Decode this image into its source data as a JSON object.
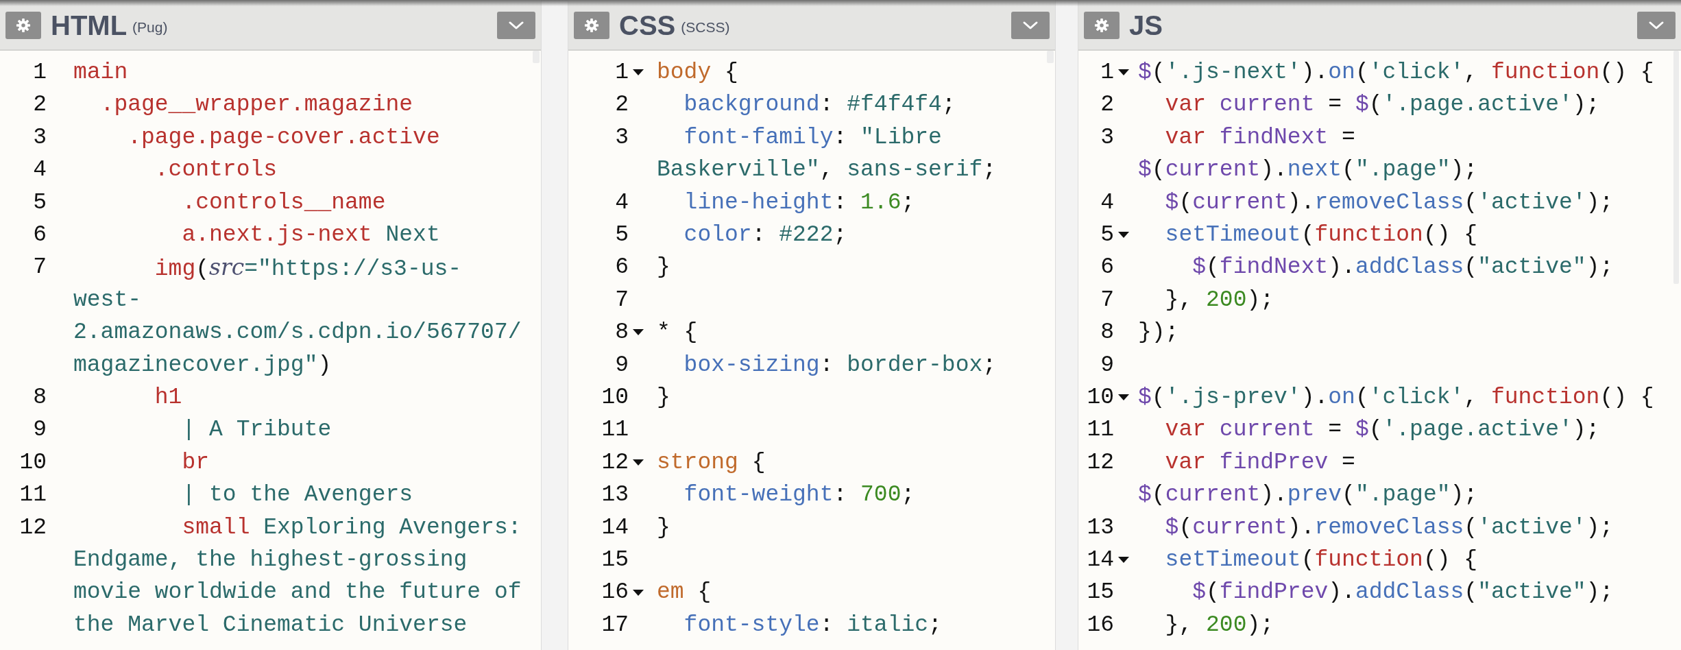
{
  "panes": [
    {
      "title": "HTML",
      "subtitle": "(Pug)",
      "lines": [
        {
          "number": "1",
          "fold": false,
          "rows": [
            {
              "tokens": [
                {
                  "kind": "tag",
                  "text": "main"
                }
              ]
            }
          ]
        },
        {
          "number": "2",
          "fold": false,
          "rows": [
            {
              "tokens": [
                {
                  "kind": "tag",
                  "text": "  .page__wrapper.magazine"
                }
              ]
            }
          ]
        },
        {
          "number": "3",
          "fold": false,
          "rows": [
            {
              "tokens": [
                {
                  "kind": "tag",
                  "text": "    .page.page-cover.active"
                }
              ]
            }
          ]
        },
        {
          "number": "4",
          "fold": false,
          "rows": [
            {
              "tokens": [
                {
                  "kind": "tag",
                  "text": "      .controls"
                }
              ]
            }
          ]
        },
        {
          "number": "5",
          "fold": false,
          "rows": [
            {
              "tokens": [
                {
                  "kind": "tag",
                  "text": "        .controls__name"
                }
              ]
            }
          ]
        },
        {
          "number": "6",
          "fold": false,
          "rows": [
            {
              "tokens": [
                {
                  "kind": "tag",
                  "text": "        a.next.js-next"
                },
                {
                  "kind": "string",
                  "text": " Next"
                }
              ]
            }
          ]
        },
        {
          "number": "7",
          "fold": false,
          "rows": [
            {
              "tokens": [
                {
                  "kind": "tag",
                  "text": "      img"
                },
                {
                  "kind": "plain",
                  "text": "("
                },
                {
                  "kind": "attribute",
                  "text": "src"
                },
                {
                  "kind": "string",
                  "text": "=\"https://s3-us-"
                }
              ]
            },
            {
              "tokens": [
                {
                  "kind": "string",
                  "text": "west-"
                }
              ]
            },
            {
              "tokens": [
                {
                  "kind": "string",
                  "text": "2.amazonaws.com/s.cdpn.io/567707/"
                }
              ]
            },
            {
              "tokens": [
                {
                  "kind": "string",
                  "text": "magazinecover.jpg\""
                },
                {
                  "kind": "plain",
                  "text": ")"
                }
              ]
            }
          ]
        },
        {
          "number": "8",
          "fold": false,
          "rows": [
            {
              "tokens": [
                {
                  "kind": "tag",
                  "text": "      h1"
                }
              ]
            }
          ]
        },
        {
          "number": "9",
          "fold": false,
          "rows": [
            {
              "tokens": [
                {
                  "kind": "string",
                  "text": "        | A Tribute"
                }
              ]
            }
          ]
        },
        {
          "number": "10",
          "fold": false,
          "rows": [
            {
              "tokens": [
                {
                  "kind": "tag",
                  "text": "        br"
                }
              ]
            }
          ]
        },
        {
          "number": "11",
          "fold": false,
          "rows": [
            {
              "tokens": [
                {
                  "kind": "string",
                  "text": "        | to the Avengers"
                }
              ]
            }
          ]
        },
        {
          "number": "12",
          "fold": false,
          "rows": [
            {
              "tokens": [
                {
                  "kind": "tag",
                  "text": "        small"
                },
                {
                  "kind": "string",
                  "text": " Exploring Avengers:"
                }
              ]
            },
            {
              "tokens": [
                {
                  "kind": "string",
                  "text": "Endgame, the highest-grossing"
                }
              ]
            },
            {
              "tokens": [
                {
                  "kind": "string",
                  "text": "movie worldwide and the future of"
                }
              ]
            },
            {
              "tokens": [
                {
                  "kind": "string",
                  "text": "the Marvel Cinematic Universe"
                }
              ]
            }
          ]
        }
      ]
    },
    {
      "title": "CSS",
      "subtitle": "(SCSS)",
      "lines": [
        {
          "number": "1",
          "fold": true,
          "rows": [
            {
              "tokens": [
                {
                  "kind": "selector",
                  "text": "body"
                },
                {
                  "kind": "plain",
                  "text": " {"
                }
              ]
            }
          ]
        },
        {
          "number": "2",
          "fold": false,
          "rows": [
            {
              "tokens": [
                {
                  "kind": "property",
                  "text": "  background"
                },
                {
                  "kind": "plain",
                  "text": ": "
                },
                {
                  "kind": "string",
                  "text": "#f4f4f4"
                },
                {
                  "kind": "plain",
                  "text": ";"
                }
              ]
            }
          ]
        },
        {
          "number": "3",
          "fold": false,
          "rows": [
            {
              "tokens": [
                {
                  "kind": "property",
                  "text": "  font-family"
                },
                {
                  "kind": "plain",
                  "text": ": "
                },
                {
                  "kind": "string",
                  "text": "\"Libre"
                }
              ]
            },
            {
              "tokens": [
                {
                  "kind": "string",
                  "text": "Baskerville\""
                },
                {
                  "kind": "plain",
                  "text": ", "
                },
                {
                  "kind": "string",
                  "text": "sans-serif"
                },
                {
                  "kind": "plain",
                  "text": ";"
                }
              ]
            }
          ]
        },
        {
          "number": "4",
          "fold": false,
          "rows": [
            {
              "tokens": [
                {
                  "kind": "property",
                  "text": "  line-height"
                },
                {
                  "kind": "plain",
                  "text": ": "
                },
                {
                  "kind": "number",
                  "text": "1.6"
                },
                {
                  "kind": "plain",
                  "text": ";"
                }
              ]
            }
          ]
        },
        {
          "number": "5",
          "fold": false,
          "rows": [
            {
              "tokens": [
                {
                  "kind": "property",
                  "text": "  color"
                },
                {
                  "kind": "plain",
                  "text": ": "
                },
                {
                  "kind": "string",
                  "text": "#222"
                },
                {
                  "kind": "plain",
                  "text": ";"
                }
              ]
            }
          ]
        },
        {
          "number": "6",
          "fold": false,
          "rows": [
            {
              "tokens": [
                {
                  "kind": "plain",
                  "text": "}"
                }
              ]
            }
          ]
        },
        {
          "number": "7",
          "fold": false
        },
        {
          "number": "8",
          "fold": true,
          "rows": [
            {
              "tokens": [
                {
                  "kind": "plain",
                  "text": "* {"
                }
              ]
            }
          ]
        },
        {
          "number": "9",
          "fold": false,
          "rows": [
            {
              "tokens": [
                {
                  "kind": "property",
                  "text": "  box-sizing"
                },
                {
                  "kind": "plain",
                  "text": ": "
                },
                {
                  "kind": "string",
                  "text": "border-box"
                },
                {
                  "kind": "plain",
                  "text": ";"
                }
              ]
            }
          ]
        },
        {
          "number": "10",
          "fold": false,
          "rows": [
            {
              "tokens": [
                {
                  "kind": "plain",
                  "text": "}"
                }
              ]
            }
          ]
        },
        {
          "number": "11",
          "fold": false
        },
        {
          "number": "12",
          "fold": true,
          "rows": [
            {
              "tokens": [
                {
                  "kind": "selector",
                  "text": "strong"
                },
                {
                  "kind": "plain",
                  "text": " {"
                }
              ]
            }
          ]
        },
        {
          "number": "13",
          "fold": false,
          "rows": [
            {
              "tokens": [
                {
                  "kind": "property",
                  "text": "  font-weight"
                },
                {
                  "kind": "plain",
                  "text": ": "
                },
                {
                  "kind": "number",
                  "text": "700"
                },
                {
                  "kind": "plain",
                  "text": ";"
                }
              ]
            }
          ]
        },
        {
          "number": "14",
          "fold": false,
          "rows": [
            {
              "tokens": [
                {
                  "kind": "plain",
                  "text": "}"
                }
              ]
            }
          ]
        },
        {
          "number": "15",
          "fold": false
        },
        {
          "number": "16",
          "fold": true,
          "rows": [
            {
              "tokens": [
                {
                  "kind": "selector",
                  "text": "em"
                },
                {
                  "kind": "plain",
                  "text": " {"
                }
              ]
            }
          ]
        },
        {
          "number": "17",
          "fold": false,
          "rows": [
            {
              "tokens": [
                {
                  "kind": "property",
                  "text": "  font-style"
                },
                {
                  "kind": "plain",
                  "text": ": "
                },
                {
                  "kind": "string",
                  "text": "italic"
                },
                {
                  "kind": "plain",
                  "text": ";"
                }
              ]
            }
          ]
        }
      ]
    },
    {
      "title": "JS",
      "lines": [
        {
          "number": "1",
          "fold": true,
          "rows": [
            {
              "tokens": [
                {
                  "kind": "variable",
                  "text": "$"
                },
                {
                  "kind": "plain",
                  "text": "("
                },
                {
                  "kind": "string",
                  "text": "'.js-next'"
                },
                {
                  "kind": "plain",
                  "text": ")."
                },
                {
                  "kind": "method",
                  "text": "on"
                },
                {
                  "kind": "plain",
                  "text": "("
                },
                {
                  "kind": "string",
                  "text": "'click'"
                },
                {
                  "kind": "plain",
                  "text": ", "
                },
                {
                  "kind": "keyword",
                  "text": "function"
                },
                {
                  "kind": "plain",
                  "text": "() {"
                }
              ]
            }
          ]
        },
        {
          "number": "2",
          "fold": false,
          "rows": [
            {
              "tokens": [
                {
                  "kind": "keyword",
                  "text": "  var"
                },
                {
                  "kind": "variable",
                  "text": " current"
                },
                {
                  "kind": "plain",
                  "text": " = "
                },
                {
                  "kind": "variable",
                  "text": "$"
                },
                {
                  "kind": "plain",
                  "text": "("
                },
                {
                  "kind": "string",
                  "text": "'.page.active'"
                },
                {
                  "kind": "plain",
                  "text": ");"
                }
              ]
            }
          ]
        },
        {
          "number": "3",
          "fold": false,
          "rows": [
            {
              "tokens": [
                {
                  "kind": "keyword",
                  "text": "  var"
                },
                {
                  "kind": "variable",
                  "text": " findNext"
                },
                {
                  "kind": "plain",
                  "text": " ="
                }
              ]
            },
            {
              "tokens": [
                {
                  "kind": "variable",
                  "text": "$"
                },
                {
                  "kind": "plain",
                  "text": "("
                },
                {
                  "kind": "variable",
                  "text": "current"
                },
                {
                  "kind": "plain",
                  "text": ")."
                },
                {
                  "kind": "method",
                  "text": "next"
                },
                {
                  "kind": "plain",
                  "text": "("
                },
                {
                  "kind": "string",
                  "text": "\".page\""
                },
                {
                  "kind": "plain",
                  "text": ");"
                }
              ]
            }
          ]
        },
        {
          "number": "4",
          "fold": false,
          "rows": [
            {
              "tokens": [
                {
                  "kind": "variable",
                  "text": "  $"
                },
                {
                  "kind": "plain",
                  "text": "("
                },
                {
                  "kind": "variable",
                  "text": "current"
                },
                {
                  "kind": "plain",
                  "text": ")."
                },
                {
                  "kind": "method",
                  "text": "removeClass"
                },
                {
                  "kind": "plain",
                  "text": "("
                },
                {
                  "kind": "string",
                  "text": "'active'"
                },
                {
                  "kind": "plain",
                  "text": ");"
                }
              ]
            }
          ]
        },
        {
          "number": "5",
          "fold": true,
          "rows": [
            {
              "tokens": [
                {
                  "kind": "method",
                  "text": "  setTimeout"
                },
                {
                  "kind": "plain",
                  "text": "("
                },
                {
                  "kind": "keyword",
                  "text": "function"
                },
                {
                  "kind": "plain",
                  "text": "() {"
                }
              ]
            }
          ]
        },
        {
          "number": "6",
          "fold": false,
          "rows": [
            {
              "tokens": [
                {
                  "kind": "variable",
                  "text": "    $"
                },
                {
                  "kind": "plain",
                  "text": "("
                },
                {
                  "kind": "variable",
                  "text": "findNext"
                },
                {
                  "kind": "plain",
                  "text": ")."
                },
                {
                  "kind": "method",
                  "text": "addClass"
                },
                {
                  "kind": "plain",
                  "text": "("
                },
                {
                  "kind": "string",
                  "text": "\"active\""
                },
                {
                  "kind": "plain",
                  "text": ");"
                }
              ]
            }
          ]
        },
        {
          "number": "7",
          "fold": false,
          "rows": [
            {
              "tokens": [
                {
                  "kind": "plain",
                  "text": "  }, "
                },
                {
                  "kind": "number",
                  "text": "200"
                },
                {
                  "kind": "plain",
                  "text": ");"
                }
              ]
            }
          ]
        },
        {
          "number": "8",
          "fold": false,
          "rows": [
            {
              "tokens": [
                {
                  "kind": "plain",
                  "text": "});"
                }
              ]
            }
          ]
        },
        {
          "number": "9",
          "fold": false
        },
        {
          "number": "10",
          "fold": true,
          "rows": [
            {
              "tokens": [
                {
                  "kind": "variable",
                  "text": "$"
                },
                {
                  "kind": "plain",
                  "text": "("
                },
                {
                  "kind": "string",
                  "text": "'.js-prev'"
                },
                {
                  "kind": "plain",
                  "text": ")."
                },
                {
                  "kind": "method",
                  "text": "on"
                },
                {
                  "kind": "plain",
                  "text": "("
                },
                {
                  "kind": "string",
                  "text": "'click'"
                },
                {
                  "kind": "plain",
                  "text": ", "
                },
                {
                  "kind": "keyword",
                  "text": "function"
                },
                {
                  "kind": "plain",
                  "text": "() {"
                }
              ]
            }
          ]
        },
        {
          "number": "11",
          "fold": false,
          "rows": [
            {
              "tokens": [
                {
                  "kind": "keyword",
                  "text": "  var"
                },
                {
                  "kind": "variable",
                  "text": " current"
                },
                {
                  "kind": "plain",
                  "text": " = "
                },
                {
                  "kind": "variable",
                  "text": "$"
                },
                {
                  "kind": "plain",
                  "text": "("
                },
                {
                  "kind": "string",
                  "text": "'.page.active'"
                },
                {
                  "kind": "plain",
                  "text": ");"
                }
              ]
            }
          ]
        },
        {
          "number": "12",
          "fold": false,
          "rows": [
            {
              "tokens": [
                {
                  "kind": "keyword",
                  "text": "  var"
                },
                {
                  "kind": "variable",
                  "text": " findPrev"
                },
                {
                  "kind": "plain",
                  "text": " ="
                }
              ]
            },
            {
              "tokens": [
                {
                  "kind": "variable",
                  "text": "$"
                },
                {
                  "kind": "plain",
                  "text": "("
                },
                {
                  "kind": "variable",
                  "text": "current"
                },
                {
                  "kind": "plain",
                  "text": ")."
                },
                {
                  "kind": "method",
                  "text": "prev"
                },
                {
                  "kind": "plain",
                  "text": "("
                },
                {
                  "kind": "string",
                  "text": "\".page\""
                },
                {
                  "kind": "plain",
                  "text": ");"
                }
              ]
            }
          ]
        },
        {
          "number": "13",
          "fold": false,
          "rows": [
            {
              "tokens": [
                {
                  "kind": "variable",
                  "text": "  $"
                },
                {
                  "kind": "plain",
                  "text": "("
                },
                {
                  "kind": "variable",
                  "text": "current"
                },
                {
                  "kind": "plain",
                  "text": ")."
                },
                {
                  "kind": "method",
                  "text": "removeClass"
                },
                {
                  "kind": "plain",
                  "text": "("
                },
                {
                  "kind": "string",
                  "text": "'active'"
                },
                {
                  "kind": "plain",
                  "text": ");"
                }
              ]
            }
          ]
        },
        {
          "number": "14",
          "fold": true,
          "rows": [
            {
              "tokens": [
                {
                  "kind": "method",
                  "text": "  setTimeout"
                },
                {
                  "kind": "plain",
                  "text": "("
                },
                {
                  "kind": "keyword",
                  "text": "function"
                },
                {
                  "kind": "plain",
                  "text": "() {"
                }
              ]
            }
          ]
        },
        {
          "number": "15",
          "fold": false,
          "rows": [
            {
              "tokens": [
                {
                  "kind": "variable",
                  "text": "    $"
                },
                {
                  "kind": "plain",
                  "text": "("
                },
                {
                  "kind": "variable",
                  "text": "findPrev"
                },
                {
                  "kind": "plain",
                  "text": ")."
                },
                {
                  "kind": "method",
                  "text": "addClass"
                },
                {
                  "kind": "plain",
                  "text": "("
                },
                {
                  "kind": "string",
                  "text": "\"active\""
                },
                {
                  "kind": "plain",
                  "text": ");"
                }
              ]
            }
          ]
        },
        {
          "number": "16",
          "fold": false,
          "rows": [
            {
              "tokens": [
                {
                  "kind": "plain",
                  "text": "  }, "
                },
                {
                  "kind": "number",
                  "text": "200"
                },
                {
                  "kind": "plain",
                  "text": ");"
                }
              ]
            }
          ]
        }
      ]
    }
  ]
}
